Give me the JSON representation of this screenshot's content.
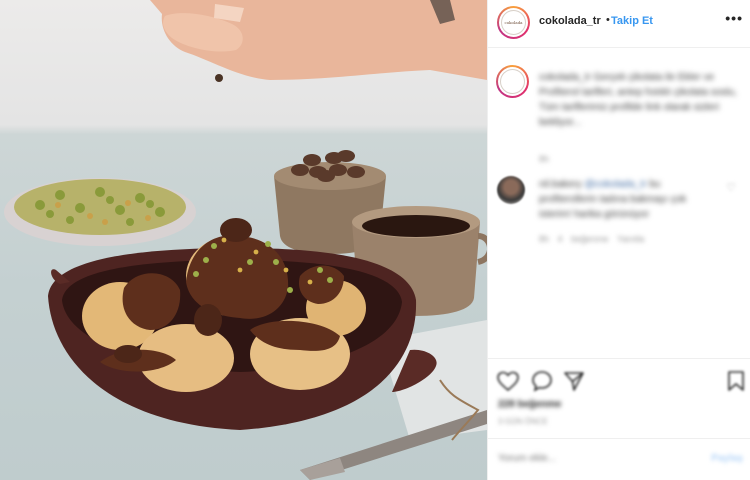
{
  "post": {
    "username": "cokolada_tr",
    "separator": "•",
    "follow_label": "Takip Et",
    "more_label": "•••",
    "avatar_logo": "cokolada",
    "caption_text": "cokolada_tr Gerçek çikolata ile Ekler ve Profiterol tarifleri, antep fıstıklı çikolata soslu, Tüm tariflerimiz profilde link olarak sizleri bekliyor...",
    "caption_meta": "8h",
    "comment_user": "nil.bakery",
    "comment_mention": "@cokolada_tr",
    "comment_text": "bu profiterollerin tadına bakmayı çok isterim! harika görünüyor",
    "comment_heart": "♡",
    "comment_meta": "8h  4 beğenme  Yanıtla",
    "likes": "228 beğenme",
    "date": "3 GÜN ÖNCE",
    "add_comment_placeholder": "Yorum ekle...",
    "post_label": "Paylaş"
  },
  "icons": {
    "like": "heart-icon",
    "comment": "comment-bubble-icon",
    "share": "share-plane-icon",
    "save": "bookmark-icon"
  },
  "colors": {
    "link_blue": "#3897f0",
    "text_dark": "#262626",
    "muted": "#9a9a9a",
    "border": "#efefef"
  }
}
